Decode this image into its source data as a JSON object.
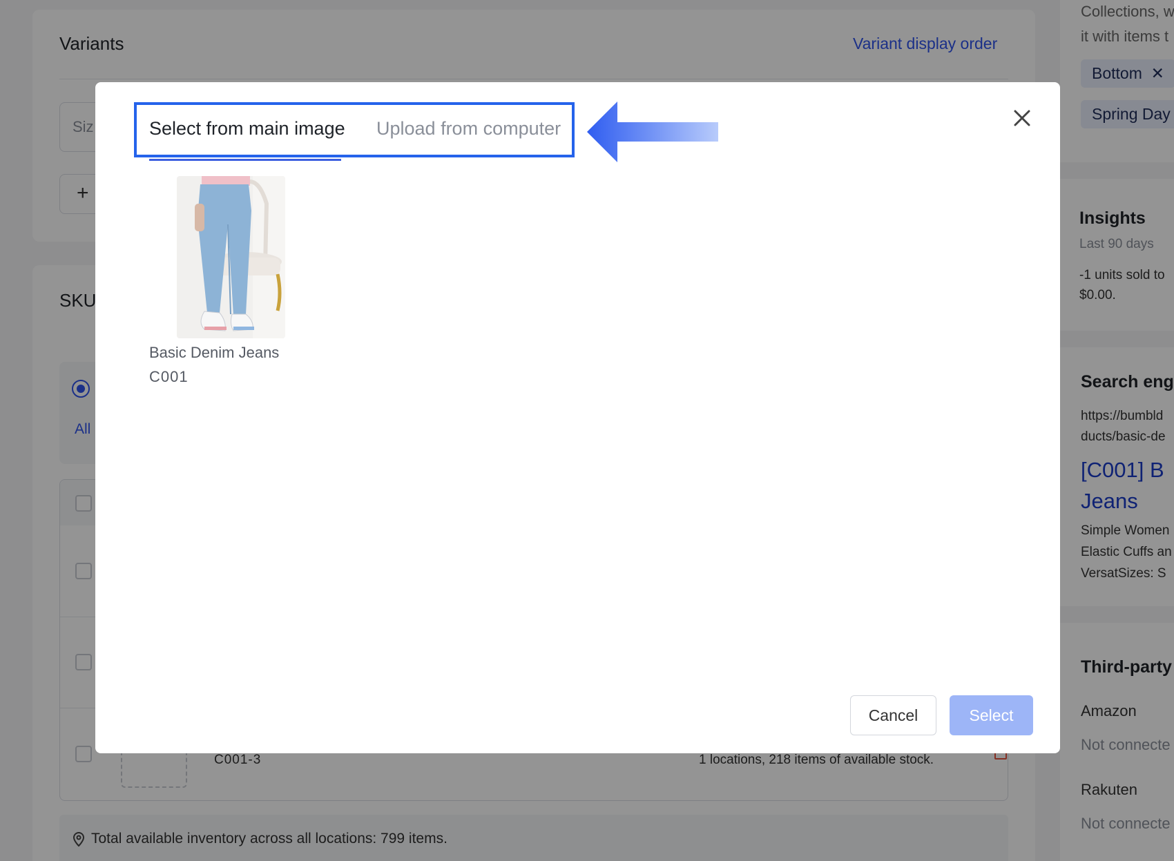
{
  "background": {
    "variants": {
      "title": "Variants",
      "display_order_link": "Variant display order",
      "size_field_partial": "Siz",
      "add_symbol": "+"
    },
    "sku": {
      "title": "SKU",
      "all_link": "All",
      "last_row_sku": "C001-3",
      "last_row_stock": "1 locations, 218 items of available stock.",
      "total_inventory": "Total available inventory across all locations: 799 items."
    },
    "sidebar": {
      "collections_text_1": "Collections, w",
      "collections_text_2": "it with items t",
      "tags": [
        "Bottom",
        "Spring Day"
      ],
      "insights": {
        "title": "Insights",
        "period": "Last 90 days",
        "line1": "-1 units sold to",
        "line2": "$0.00."
      },
      "seo": {
        "title": "Search eng",
        "url_line1": "https://bumbld",
        "url_line2": "ducts/basic-de",
        "preview_title_1": "[C001] B",
        "preview_title_2": "Jeans",
        "desc_1": "Simple Women",
        "desc_2": "Elastic Cuffs an",
        "desc_3": "VersatSizes: S"
      },
      "third_party": {
        "title": "Third-party",
        "channels": [
          {
            "name": "Amazon",
            "status": "Not connecte"
          },
          {
            "name": "Rakuten",
            "status": "Not connecte"
          }
        ]
      }
    }
  },
  "modal": {
    "tabs": [
      {
        "label": "Select from main image",
        "active": true
      },
      {
        "label": "Upload from computer",
        "active": false
      }
    ],
    "product": {
      "name": "Basic Denim Jeans",
      "sku": "C001"
    },
    "buttons": {
      "cancel": "Cancel",
      "select": "Select"
    }
  },
  "colors": {
    "accent": "#2563eb",
    "select_disabled": "#9db5f7",
    "link": "#2f54eb"
  },
  "icons": {
    "close": "close-icon",
    "arrow": "arrow-left-icon",
    "location": "location-pin-icon",
    "tag_remove": "close-small-icon"
  }
}
